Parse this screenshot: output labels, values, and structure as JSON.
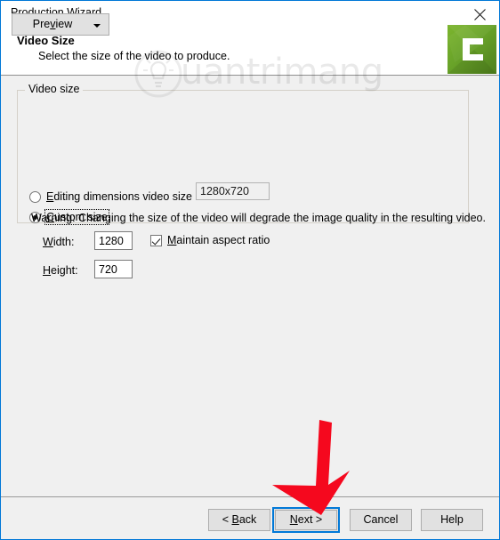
{
  "window": {
    "title": "Production Wizard",
    "close_icon": "close-icon",
    "accent_color": "#0078d7",
    "body_background": "#f0f0f0"
  },
  "header": {
    "title": "Video Size",
    "subtitle": "Select the size of the video to produce.",
    "logo_icon": "camtasia-logo-icon",
    "logo_color": "#6aa32a"
  },
  "watermark": {
    "text": "uantrimang",
    "icon": "lightbulb-icon"
  },
  "form": {
    "group_legend": "Video size",
    "options": [
      {
        "label_prefix": "",
        "accel": "E",
        "label_rest": "diting dimensions video size",
        "selected": false,
        "focused": false
      },
      {
        "label_prefix": "",
        "accel": "C",
        "label_rest": "ustom size",
        "selected": true,
        "focused": true
      }
    ],
    "editing_dimensions_value": "1280x720",
    "width": {
      "accel": "W",
      "label_rest": "idth:",
      "value": "1280"
    },
    "height": {
      "accel": "H",
      "label_rest": "eight:",
      "value": "720"
    },
    "maintain_aspect": {
      "accel": "M",
      "label_rest": "aintain aspect ratio",
      "checked": true
    },
    "warning": "Warning: Changing the size of the video will degrade the image quality in the resulting video."
  },
  "annotation": {
    "arrow_color": "#f5081e",
    "points_to": "next-button"
  },
  "footer": {
    "preview": {
      "label": "Pre",
      "accel": "v",
      "label_rest": "iew",
      "has_dropdown": true
    },
    "back": {
      "label_prefix": "< ",
      "accel": "B",
      "label_rest": "ack"
    },
    "next": {
      "label_prefix": "",
      "accel": "N",
      "label_rest": "ext >",
      "focused": true
    },
    "cancel": {
      "label": "Cancel"
    },
    "help": {
      "label": "Help"
    }
  }
}
